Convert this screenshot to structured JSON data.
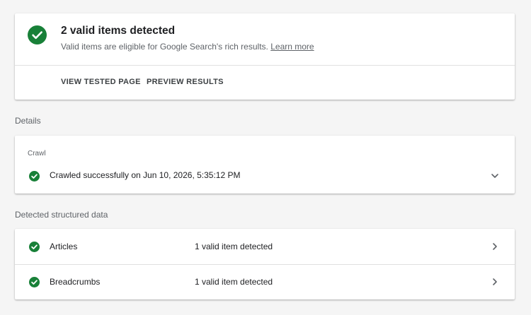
{
  "summary": {
    "title": "2 valid items detected",
    "subtitle": "Valid items are eligible for Google Search's rich results.",
    "learn_more": "Learn more",
    "actions": {
      "view_tested_page": "VIEW TESTED PAGE",
      "preview_results": "PREVIEW RESULTS"
    }
  },
  "details": {
    "label": "Details",
    "crawl": {
      "heading": "Crawl",
      "status": "Crawled successfully on Jun 10, 2026, 5:35:12 PM",
      "status_icon": "check-circle-icon",
      "toggle_icon": "chevron-down-icon"
    }
  },
  "structured": {
    "label": "Detected structured data",
    "items": [
      {
        "name": "Articles",
        "status": "1 valid item detected",
        "status_icon": "check-circle-icon",
        "nav_icon": "chevron-right-icon"
      },
      {
        "name": "Breadcrumbs",
        "status": "1 valid item detected",
        "status_icon": "check-circle-icon",
        "nav_icon": "chevron-right-icon"
      }
    ]
  },
  "colors": {
    "success_green": "#188038",
    "background": "#f5f5f5",
    "card": "#ffffff",
    "secondary_text": "#5f6368"
  }
}
